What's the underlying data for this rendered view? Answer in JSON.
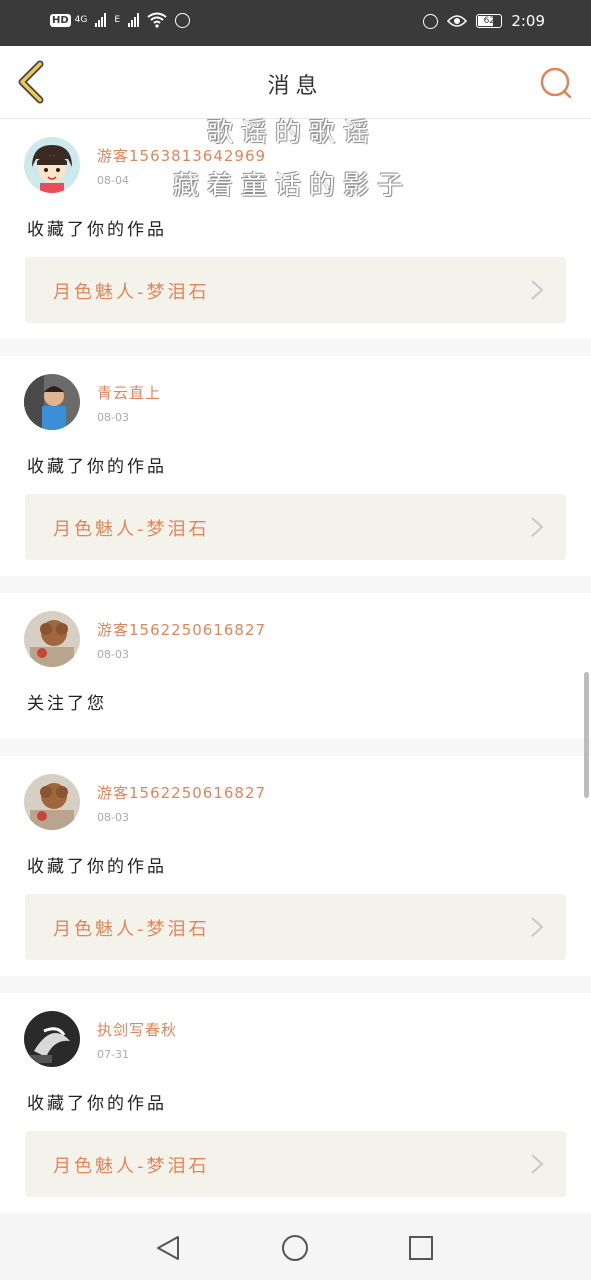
{
  "status_bar": {
    "network_left": "HD",
    "network_type": "4G",
    "edge": "E",
    "battery_level": "62",
    "time": "2:09"
  },
  "header": {
    "title": "消息"
  },
  "watermark": {
    "line1": "歌谣的歌谣",
    "line2": "藏着童话的影子"
  },
  "messages": [
    {
      "user": "游客1563813642969",
      "date": "08-04",
      "action": "收藏了你的作品",
      "work": "月色魅人-梦泪石"
    },
    {
      "user": "青云直上",
      "date": "08-03",
      "action": "收藏了你的作品",
      "work": "月色魅人-梦泪石"
    },
    {
      "user": "游客1562250616827",
      "date": "08-03",
      "action": "关注了您",
      "work": ""
    },
    {
      "user": "游客1562250616827",
      "date": "08-03",
      "action": "收藏了你的作品",
      "work": "月色魅人-梦泪石"
    },
    {
      "user": "执剑写春秋",
      "date": "07-31",
      "action": "收藏了你的作品",
      "work": "月色魅人-梦泪石"
    }
  ],
  "colors": {
    "accent": "#e0855a",
    "status_bar": "#3a3a3a",
    "work_bg": "#f3f3ec"
  },
  "icons": {
    "back": "chevron-left-icon",
    "search": "search-icon",
    "nav_back": "triangle-back-icon",
    "nav_home": "circle-home-icon",
    "nav_recent": "square-recent-icon"
  }
}
